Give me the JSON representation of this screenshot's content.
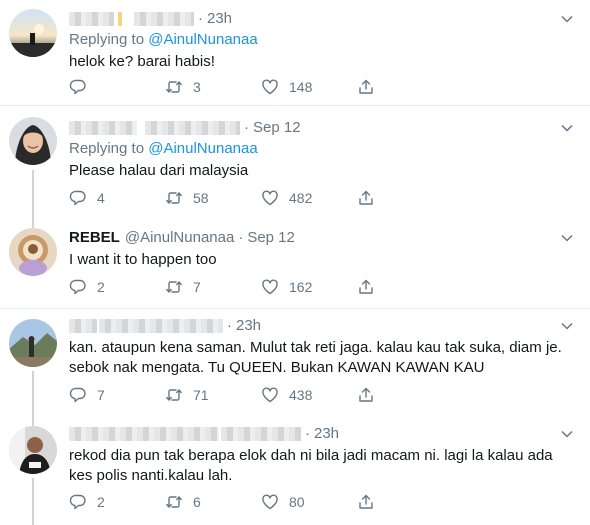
{
  "tweets": [
    {
      "name": "",
      "handle": "",
      "time": "23h",
      "replying_label": "Replying to",
      "replying_handle": "@AinulNunanaa",
      "text": "helok ke? barai habis!",
      "replies": "",
      "retweets": "3",
      "likes": "148"
    },
    {
      "name": "",
      "handle": "",
      "time": "Sep 12",
      "replying_label": "Replying to",
      "replying_handle": "@AinulNunanaa",
      "text": "Please halau dari malaysia",
      "replies": "4",
      "retweets": "58",
      "likes": "482"
    },
    {
      "name": "REBEL",
      "handle": "@AinulNunanaa",
      "time": "Sep 12",
      "text": "I want it to happen too",
      "replies": "2",
      "retweets": "7",
      "likes": "162"
    },
    {
      "name": "",
      "handle": "",
      "time": "23h",
      "text": "kan. ataupun kena saman. Mulut tak reti jaga. kalau kau tak suka, diam je. sebok nak mengata. Tu QUEEN. Bukan KAWAN KAWAN KAU",
      "replies": "7",
      "retweets": "71",
      "likes": "438"
    },
    {
      "name": "",
      "handle": "",
      "time": "23h",
      "text": "rekod dia pun tak berapa elok dah ni bila jadi macam ni. lagi la kalau ada kes polis nanti.kalau lah.",
      "replies": "2",
      "retweets": "6",
      "likes": "80"
    }
  ],
  "icons": {
    "reply": "reply-icon",
    "retweet": "retweet-icon",
    "like": "heart-icon",
    "share": "share-icon",
    "more": "chevron-down-icon"
  },
  "colors": {
    "link": "#1b95e0",
    "muted": "#657786",
    "divider": "#e6ecf0",
    "thread_line": "#ccd6dd"
  }
}
